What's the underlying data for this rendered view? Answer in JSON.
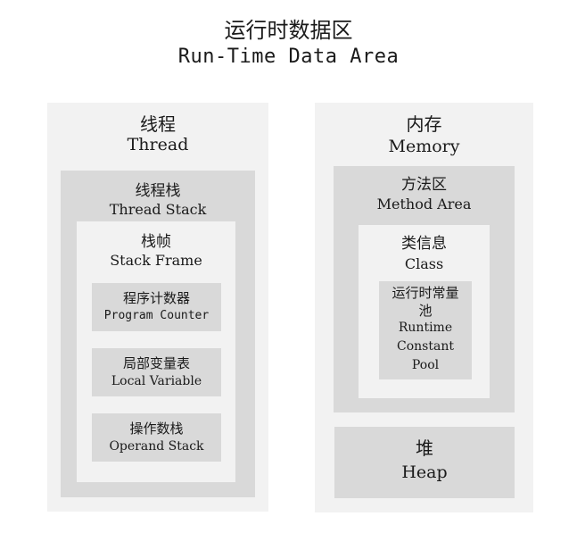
{
  "title": {
    "zh": "运行时数据区",
    "en": "Run-Time Data Area"
  },
  "thread": {
    "zh": "线程",
    "en": "Thread",
    "stack": {
      "zh": "线程栈",
      "en": "Thread Stack",
      "frame": {
        "zh": "栈帧",
        "en": "Stack Frame",
        "items": [
          {
            "zh": "程序计数器",
            "en": "Program Counter"
          },
          {
            "zh": "局部变量表",
            "en": "Local Variable"
          },
          {
            "zh": "操作数栈",
            "en": "Operand Stack"
          }
        ]
      }
    }
  },
  "memory": {
    "zh": "内存",
    "en": "Memory",
    "method_area": {
      "zh": "方法区",
      "en": "Method Area",
      "class": {
        "zh": "类信息",
        "en": "Class",
        "pool": {
          "zh_line1": "运行时常量",
          "zh_line2": "池",
          "en_line1": "Runtime",
          "en_line2": "Constant",
          "en_line3": "Pool"
        }
      }
    },
    "heap": {
      "zh": "堆",
      "en": "Heap"
    }
  }
}
